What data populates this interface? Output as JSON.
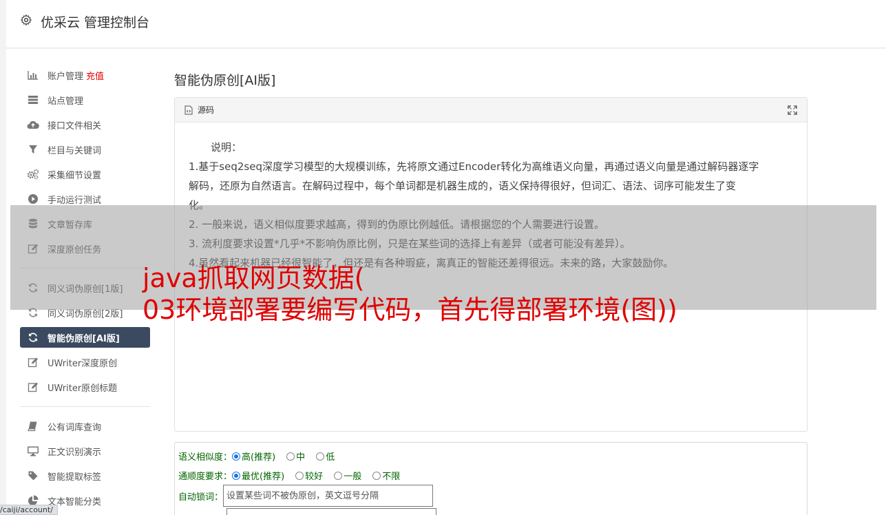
{
  "header": {
    "title": "优采云 管理控制台",
    "icon": "gear-icon"
  },
  "sidebar": {
    "group1": [
      {
        "label": "账户管理",
        "badge": "充值",
        "icon": "bar-chart-icon"
      },
      {
        "label": "站点管理",
        "icon": "server-icon"
      },
      {
        "label": "接口文件相关",
        "icon": "cloud-upload-icon"
      },
      {
        "label": "栏目与关键词",
        "icon": "filter-icon"
      },
      {
        "label": "采集细节设置",
        "icon": "cogs-icon"
      },
      {
        "label": "手动运行测试",
        "icon": "play-circle-icon"
      },
      {
        "label": "文章暂存库",
        "icon": "database-icon"
      },
      {
        "label": "深度原创任务",
        "icon": "edit-icon"
      }
    ],
    "group2": [
      {
        "label": "同义词伪原创[1版]",
        "icon": "refresh-icon"
      },
      {
        "label": "同义词伪原创[2版]",
        "icon": "refresh-icon"
      },
      {
        "label": "智能伪原创[AI版]",
        "icon": "refresh-icon",
        "active": true
      },
      {
        "label": "UWriter深度原创",
        "icon": "edit-icon"
      },
      {
        "label": "UWriter原创标题",
        "icon": "edit-icon"
      }
    ],
    "group3": [
      {
        "label": "公有词库查询",
        "icon": "book-icon"
      },
      {
        "label": "正文识别演示",
        "icon": "desktop-icon"
      },
      {
        "label": "智能提取标签",
        "icon": "tag-icon"
      },
      {
        "label": "文本智能分类",
        "icon": "pie-chart-icon"
      }
    ]
  },
  "main": {
    "title": "智能伪原创[AI版]",
    "editor": {
      "toolbar_label": "源码",
      "lines": [
        "说明：",
        "1.基于seq2seq深度学习模型的大规模训练，先将原文通过Encoder转化为高维语义向量，再通过语义向量是通过解码器逐字",
        "解码，还原为自然语言。在解码过程中，每个单词都是机器生成的，语义保持得很好，但词汇、语法、词序可能发生了变",
        "化。",
        "2. 一般来说，语义相似度要求越高，得到的伪原比例越低。请根据您的个人需要进行设置。",
        "3. 流利度要求设置*几乎*不影响伪原比例，只是在某些词的选择上有差异（或者可能没有差异）。",
        "4.虽然看起来机器已经很智能了，但还是有各种瑕疵，离真正的智能还差得很远。未来的路，大家鼓励你。"
      ]
    },
    "form": {
      "similarity_label": "语义相似度：",
      "similarity_options": [
        "高(推荐)",
        "中",
        "低"
      ],
      "fluency_label": "通顺度要求：",
      "fluency_options": [
        "最优(推荐)",
        "较好",
        "一般",
        "不限"
      ],
      "lock_label": "自动锁词：",
      "lock_placeholder": "设置某些词不被伪原创，英文逗号分隔"
    }
  },
  "overlay": {
    "headline_line1": "java抓取网页数据(",
    "headline_line2": "03环境部署要编写代码，首先得部署环境(图))"
  },
  "status_url": "/caiji/account/",
  "colors": {
    "active_nav_bg": "#3b4a60",
    "badge": "#e60000",
    "headline": "#e00000",
    "form_label": "#006400"
  }
}
